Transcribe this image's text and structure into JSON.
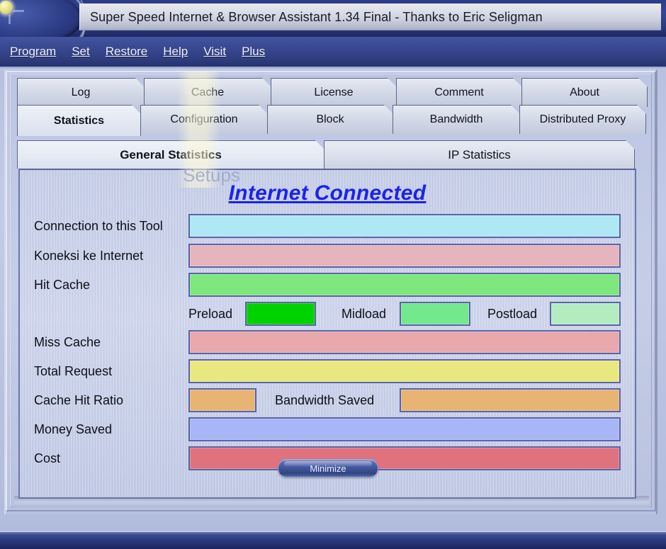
{
  "window": {
    "title": "Super Speed Internet & Browser Assistant 1.34 Final - Thanks to Eric Seligman",
    "app_icon": "starburst-globe-icon",
    "watermark": "Setups"
  },
  "menubar": {
    "items": [
      {
        "accel": "P",
        "rest": "rogram"
      },
      {
        "accel": "S",
        "rest": "et"
      },
      {
        "accel": "R",
        "rest": "estore"
      },
      {
        "accel": "H",
        "rest": "elp"
      },
      {
        "accel": "V",
        "rest": "isit"
      },
      {
        "accel": "P",
        "rest": "lus"
      }
    ]
  },
  "tabs": {
    "top_row": [
      {
        "label": "Log",
        "active": false
      },
      {
        "label": "Cache",
        "active": false
      },
      {
        "label": "License",
        "active": false
      },
      {
        "label": "Comment",
        "active": false
      },
      {
        "label": "About",
        "active": false
      }
    ],
    "bottom_row": [
      {
        "label": "Statistics",
        "active": true
      },
      {
        "label": "Configuration",
        "active": false
      },
      {
        "label": "Block",
        "active": false
      },
      {
        "label": "Bandwidth",
        "active": false
      },
      {
        "label": "Distributed Proxy",
        "active": false
      }
    ]
  },
  "subtabs": [
    {
      "label": "General Statistics",
      "active": true
    },
    {
      "label": "IP Statistics",
      "active": false
    }
  ],
  "statistics": {
    "status_heading": "Internet Connected",
    "status_color": "#1b24e8",
    "rows": [
      {
        "label": "Connection to this Tool",
        "value": "",
        "color": "#aee8f5"
      },
      {
        "label": "Koneksi ke Internet",
        "value": "",
        "color": "#e6b4bc"
      },
      {
        "label": "Hit Cache",
        "value": "",
        "color": "#7ee87e"
      },
      {
        "label": "Miss Cache",
        "value": "",
        "color": "#e8a8ac"
      },
      {
        "label": "Total Request",
        "value": "",
        "color": "#e8e87e"
      },
      {
        "label": "Cache Hit Ratio",
        "value": "",
        "color": "#e8b473"
      },
      {
        "label": "Money Saved",
        "value": "",
        "color": "#a8b6f5"
      },
      {
        "label": "Cost",
        "value": "",
        "color": "#e0727e"
      }
    ],
    "load_meters": [
      {
        "label": "Preload",
        "value": "",
        "color": "#00d200"
      },
      {
        "label": "Midload",
        "value": "",
        "color": "#73e88c"
      },
      {
        "label": "Postload",
        "value": "",
        "color": "#b4ecc0"
      }
    ],
    "bandwidth_saved": {
      "label": "Bandwidth Saved",
      "value": "",
      "color": "#e8b473"
    },
    "minimize_label": "Minimize"
  }
}
